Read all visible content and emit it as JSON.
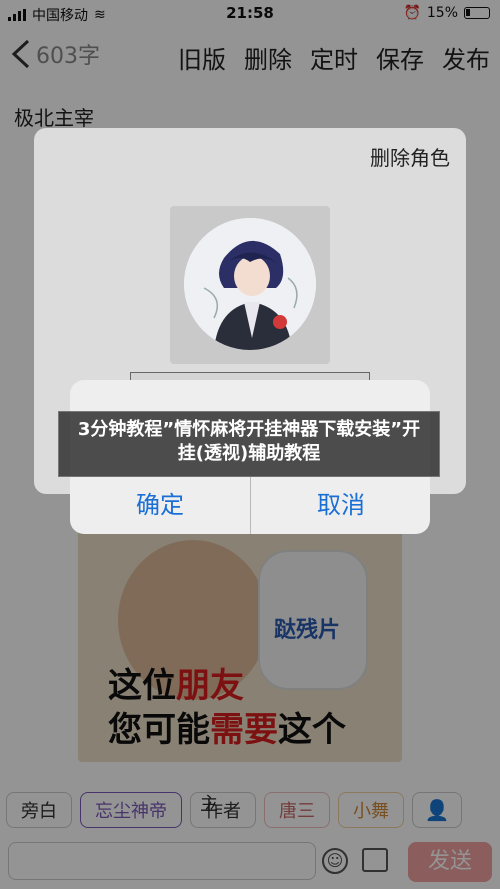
{
  "status_bar": {
    "carrier": "中国移动",
    "time": "21:58",
    "battery": "15%"
  },
  "nav": {
    "back_icon": "chevron-left-icon",
    "char_count": "603字",
    "actions": [
      "旧版",
      "删除",
      "定时",
      "保存",
      "发布"
    ]
  },
  "section_title": "极北主宰",
  "banner": {
    "line1_a": "这位",
    "line1_b": "朋友",
    "line2_a": "您可能",
    "line2_b": "需要",
    "line2_c": "这个",
    "product": "跶残片"
  },
  "roles": [
    {
      "label": "旁白",
      "style": "normal"
    },
    {
      "label": "忘尘神帝",
      "style": "sel"
    },
    {
      "label": "作者",
      "style": "normal"
    },
    {
      "label": "唐三",
      "style": "pink"
    },
    {
      "label": "小舞",
      "style": "orange"
    }
  ],
  "role_tag": "主",
  "input": {
    "send_label": "发送",
    "emoji_icon": "emoji-icon",
    "image_icon": "image-icon"
  },
  "dialog": {
    "title": "删除角色"
  },
  "alert": {
    "confirm_label": "确定",
    "cancel_label": "取消"
  },
  "caption": "3分钟教程”情怀麻将开挂神器下载安装”开挂(透视)辅助教程",
  "colors": {
    "accent": "#1a6fd6",
    "send": "#f0a0a0",
    "selected_role": "#7a5ab8"
  }
}
